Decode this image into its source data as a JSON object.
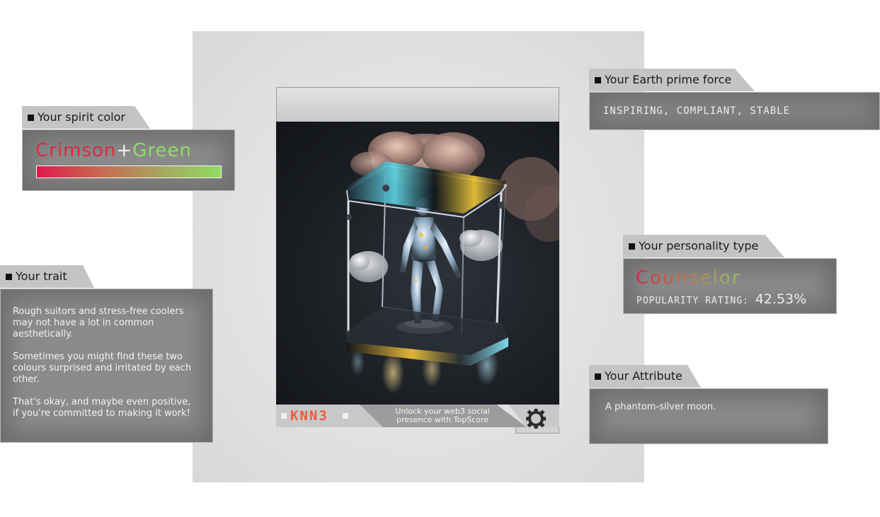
{
  "card": {
    "logo": "KNN3",
    "footer_text": "Unlock your web3 social presence with TopScore",
    "gear_icon": "gear-icon"
  },
  "spirit_color": {
    "title": "Your spirit color",
    "color_a": "Crimson",
    "plus": "+",
    "color_b": "Green",
    "colors": {
      "a": "#dc2a45",
      "b": "#8fdc62"
    }
  },
  "trait": {
    "title": "Your trait",
    "paragraphs": [
      "Rough suitors and stress-free coolers may not have a lot in common aesthetically.",
      "Sometimes you might find these two colours surprised and irritated by each other.",
      "That's okay, and maybe even positive, if you're committed to making it work!"
    ]
  },
  "earth_force": {
    "title": "Your Earth prime force",
    "value": "INSPIRING, COMPLIANT, STABLE"
  },
  "personality": {
    "title": "Your personality type",
    "name": "Counselor",
    "popularity_label": "POPULARITY RATING:",
    "popularity_value": "42.53%"
  },
  "attribute": {
    "title": "Your Attribute",
    "value": "A phantom-silver moon."
  }
}
